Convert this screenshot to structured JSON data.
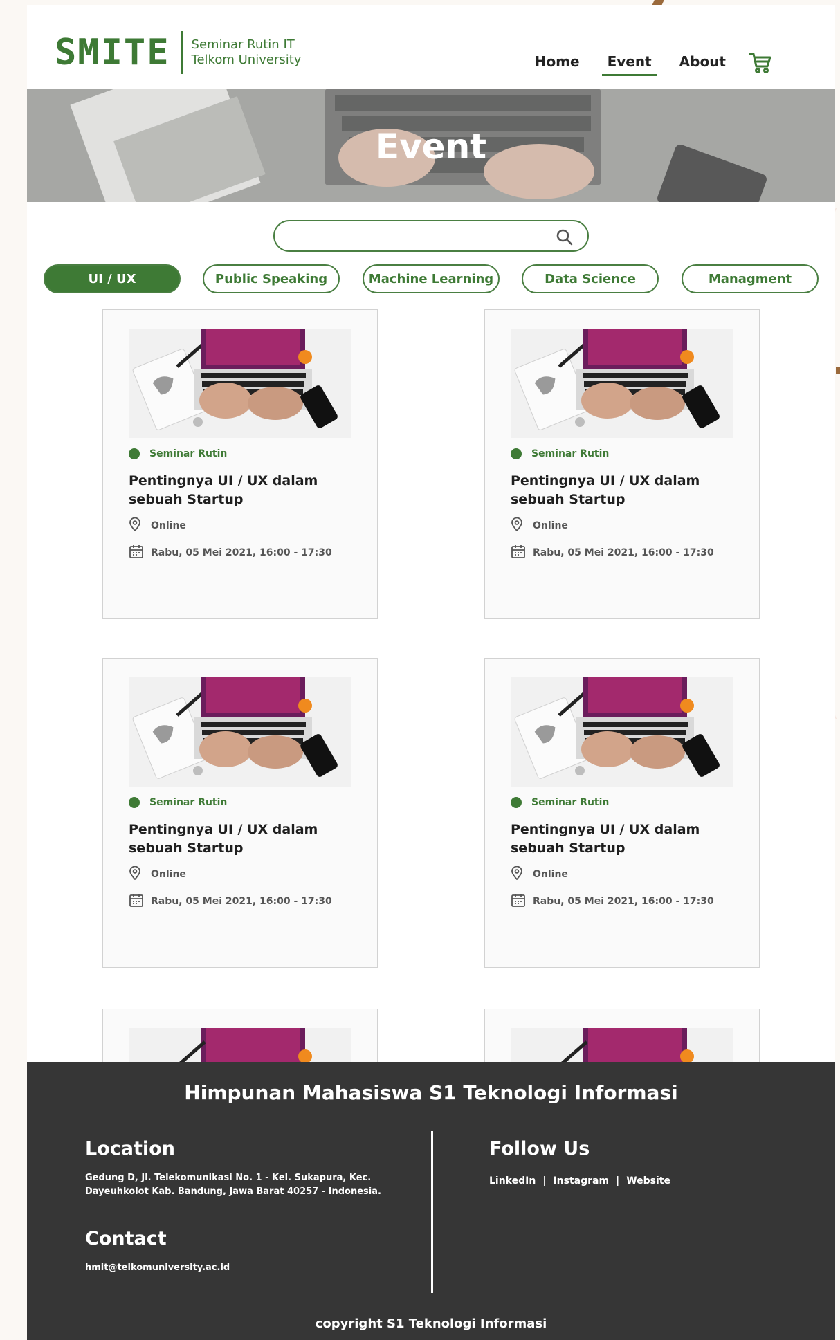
{
  "header": {
    "logo_text": "SMITE",
    "logo_sub_line1": "Seminar Rutin IT",
    "logo_sub_line2": "Telkom University",
    "nav": [
      {
        "label": "Home"
      },
      {
        "label": "Event",
        "active": true
      },
      {
        "label": "About"
      }
    ],
    "cart_icon": "cart-icon"
  },
  "hero": {
    "title": "Event"
  },
  "search": {
    "value": "",
    "placeholder": "",
    "icon": "search-icon"
  },
  "categories": [
    {
      "label": "UI / UX",
      "active": true
    },
    {
      "label": "Public Speaking"
    },
    {
      "label": "Machine Learning"
    },
    {
      "label": "Data Science"
    },
    {
      "label": "Managment"
    }
  ],
  "events": [
    {
      "category": "Seminar Rutin",
      "title_line1": "Pentingnya UI / UX dalam",
      "title_line2": "sebuah Startup",
      "location": "Online",
      "datetime": "Rabu, 05 Mei 2021, 16:00 - 17:30"
    },
    {
      "category": "Seminar Rutin",
      "title_line1": "Pentingnya UI / UX dalam",
      "title_line2": "sebuah Startup",
      "location": "Online",
      "datetime": "Rabu, 05 Mei 2021, 16:00 - 17:30"
    },
    {
      "category": "Seminar Rutin",
      "title_line1": "Pentingnya UI / UX dalam",
      "title_line2": "sebuah Startup",
      "location": "Online",
      "datetime": "Rabu, 05 Mei 2021, 16:00 - 17:30"
    },
    {
      "category": "Seminar Rutin",
      "title_line1": "Pentingnya UI / UX dalam",
      "title_line2": "sebuah Startup",
      "location": "Online",
      "datetime": "Rabu, 05 Mei 2021, 16:00 - 17:30"
    }
  ],
  "footer": {
    "title": "Himpunan Mahasiswa S1 Teknologi Informasi",
    "location_heading": "Location",
    "location_line1": "Gedung D, Jl. Telekomunikasi No. 1 - Kel. Sukapura, Kec.",
    "location_line2": "Dayeuhkolot Kab. Bandung, Jawa Barat 40257 - Indonesia.",
    "contact_heading": "Contact",
    "contact_email": "hmit@telkomuniversity.ac.id",
    "follow_heading": "Follow Us",
    "links": [
      "LinkedIn",
      "Instagram",
      "Website"
    ],
    "separator": "|",
    "copyright": "copyright S1 Teknologi Informasi"
  },
  "colors": {
    "brand_green": "#3e7a35",
    "footer_bg": "#363636",
    "card_bg": "#fafafa"
  }
}
